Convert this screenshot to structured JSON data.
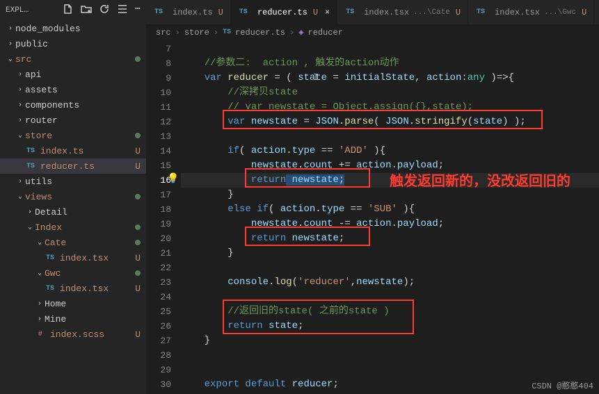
{
  "explorer": {
    "title": "EXPL…",
    "tree": {
      "node_modules": "node_modules",
      "public": "public",
      "src": "src",
      "api": "api",
      "assets": "assets",
      "components": "components",
      "router": "router",
      "store": "store",
      "index_ts": "index.ts",
      "reducer_ts": "reducer.ts",
      "utils": "utils",
      "views": "views",
      "detail": "Detail",
      "index": "Index",
      "cate": "Cate",
      "index_tsx": "index.tsx",
      "gwc": "Gwc",
      "index_tsx2": "index.tsx",
      "home": "Home",
      "mine": "Mine",
      "index_scss": "index.scss"
    },
    "mod": "U"
  },
  "tabs": {
    "t1": "index.ts",
    "t2": "reducer.ts",
    "t3": "index.tsx",
    "t3_path": "...\\Cate",
    "t4": "index.tsx",
    "t4_path": "...\\Gwc",
    "mod": "U",
    "ts_badge": "TS"
  },
  "crumbs": {
    "c1": "src",
    "c2": "store",
    "c3": "reducer.ts",
    "c4": "reducer"
  },
  "lines": {
    "n7": "7",
    "n8": "8",
    "n9": "9",
    "n10": "10",
    "n11": "11",
    "n12": "12",
    "n13": "13",
    "n14": "14",
    "n15": "15",
    "n16": "16",
    "n17": "17",
    "n18": "18",
    "n19": "19",
    "n20": "20",
    "n21": "21",
    "n22": "22",
    "n23": "23",
    "n24": "24",
    "n25": "25",
    "n26": "26",
    "n27": "27",
    "n28": "28",
    "n29": "29",
    "n30": "30"
  },
  "code": {
    "l8": "//参数二:  action , 触发的action动作",
    "l9_var": "var",
    "l9_reducer": " reducer ",
    "l9_eq": "= ( ",
    "l9_state": "state",
    "l9_eq2": " = ",
    "l9_initial": "initialState",
    "l9_comma": ", ",
    "l9_action": "action",
    "l9_colon": ":",
    "l9_any": "any",
    "l9_end": " )=>{",
    "l10": "//深拷贝state",
    "l11": "// var newstate = Object.assign({},state);",
    "l12_var": "var",
    "l12_new": " newstate ",
    "l12_eq": "= ",
    "l12_json": "JSON",
    "l12_dot": ".",
    "l12_parse": "parse",
    "l12_p1": "( ",
    "l12_json2": "JSON",
    "l12_dot2": ".",
    "l12_str": "stringify",
    "l12_p2": "(",
    "l12_state": "state",
    "l12_p3": ") );",
    "l14_if": "if",
    "l14_cond": "( ",
    "l14_action": "action",
    "l14_dot": ".",
    "l14_type": "type",
    "l14_eq": " == ",
    "l14_add": "'ADD'",
    "l14_end": " ){",
    "l15_new": "newstate",
    "l15_dot": ".",
    "l15_count": "count",
    "l15_pe": " += ",
    "l15_action": "action",
    "l15_dot2": ".",
    "l15_payload": "payload",
    "l15_sc": ";",
    "l16_ret": "return",
    "l16_new": " newstate",
    "l16_sc": ";",
    "l17": "}",
    "l18_else": "else if",
    "l18_cond": "( ",
    "l18_action": "action",
    "l18_dot": ".",
    "l18_type": "type",
    "l18_eq": " == ",
    "l18_sub": "'SUB'",
    "l18_end": " ){",
    "l19_new": "newstate",
    "l19_dot": ".",
    "l19_count": "count",
    "l19_me": " -= ",
    "l19_action": "action",
    "l19_dot2": ".",
    "l19_payload": "payload",
    "l19_sc": ";",
    "l20_ret": "return",
    "l20_new": " newstate",
    "l20_sc": ";",
    "l21": "}",
    "l23_cl": "console",
    "l23_dot": ".",
    "l23_log": "log",
    "l23_p": "(",
    "l23_str": "'reducer'",
    "l23_c": ",",
    "l23_new": "newstate",
    "l23_end": ");",
    "l25": "//返回旧的state( 之前的state )",
    "l26_ret": "return",
    "l26_state": " state",
    "l26_sc": ";",
    "l27": "}",
    "l30_exp": "export default",
    "l30_red": " reducer",
    "l30_sc": ";"
  },
  "annotation": "触发返回新的，没改返回旧的",
  "watermark": "CSDN @憨憨404"
}
